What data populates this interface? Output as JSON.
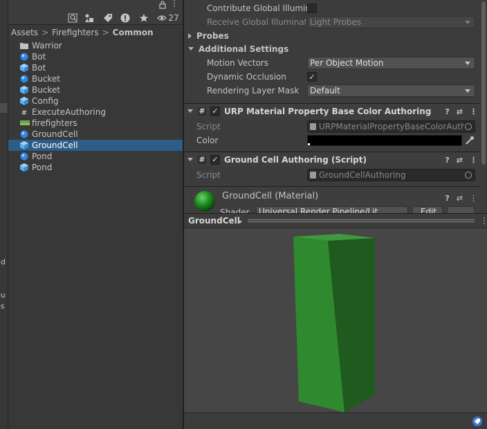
{
  "left_strip": {
    "fragments": [
      "nd",
      "ou",
      "es"
    ]
  },
  "project": {
    "toolbar": {
      "hidden_count": "27"
    },
    "breadcrumb": [
      "Assets",
      "Firefighters",
      "Common"
    ],
    "assets": [
      {
        "label": "Warrior",
        "icon": "folder-icon"
      },
      {
        "label": "Bot",
        "icon": "scene-icon"
      },
      {
        "label": "Bot",
        "icon": "prefab-icon"
      },
      {
        "label": "Bucket",
        "icon": "scene-icon"
      },
      {
        "label": "Bucket",
        "icon": "prefab-icon"
      },
      {
        "label": "Config",
        "icon": "prefab-icon"
      },
      {
        "label": "ExecuteAuthoring",
        "icon": "script-icon"
      },
      {
        "label": "firefighters",
        "icon": "terrain-icon"
      },
      {
        "label": "GroundCell",
        "icon": "scene-icon"
      },
      {
        "label": "GroundCell",
        "icon": "prefab-icon",
        "selected": true
      },
      {
        "label": "Pond",
        "icon": "scene-icon"
      },
      {
        "label": "Pond",
        "icon": "prefab-icon"
      }
    ]
  },
  "inspector": {
    "contribute_gi": "Contribute Global Illumina",
    "receive_gi": {
      "label": "Receive Global Illuminatic",
      "value": "Light Probes"
    },
    "probes": "Probes",
    "additional_settings": "Additional Settings",
    "motion_vectors": {
      "label": "Motion Vectors",
      "value": "Per Object Motion"
    },
    "dynamic_occlusion": {
      "label": "Dynamic Occlusion",
      "checked": true
    },
    "rendering_layer_mask": {
      "label": "Rendering Layer Mask",
      "value": "Default"
    },
    "urp_component": {
      "title": "URP Material Property Base Color Authoring (Script)",
      "script_label": "Script",
      "script_value": "URPMaterialPropertyBaseColorAuthoring",
      "color_label": "Color",
      "color_value": "#000000"
    },
    "groundcell_component": {
      "title": "Ground Cell Authoring (Script)",
      "script_label": "Script",
      "script_value": "GroundCellAuthoring"
    },
    "material": {
      "title": "GroundCell (Material)",
      "shader_label": "Shader",
      "shader_value": "Universal Render Pipeline/Lit",
      "edit_label": "Edit"
    }
  },
  "preview": {
    "name": "GroundCell",
    "object_color": "#2f8a2f"
  },
  "colors": {
    "selection": "#2c5d87",
    "panel": "#383838",
    "inspector": "#3c3c3c"
  }
}
